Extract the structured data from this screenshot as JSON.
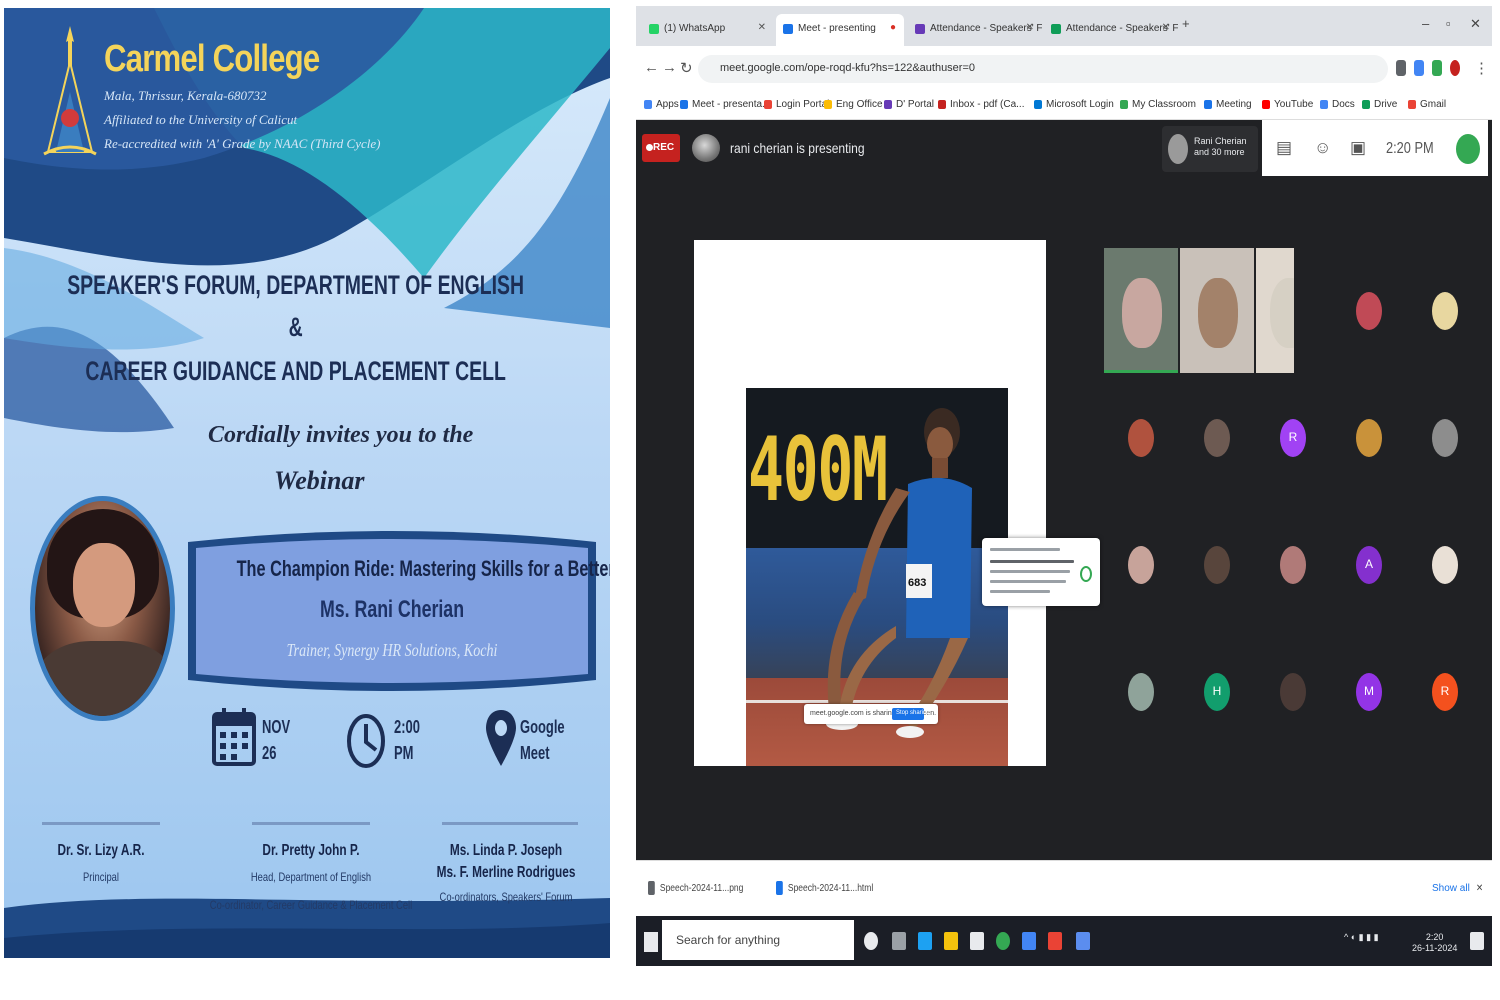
{
  "poster": {
    "college_name": "Carmel College",
    "address": "Mala, Thrissur, Kerala-680732",
    "affiliation": "Affiliated to the University of Calicut",
    "accreditation": "Re-accredited with 'A' Grade by NAAC (Third Cycle)",
    "heading_line1": "SPEAKER'S FORUM, DEPARTMENT OF ENGLISH",
    "heading_amp": "&",
    "heading_line2": "CAREER GUIDANCE AND PLACEMENT CELL",
    "invite_line1": "Cordially invites you to the",
    "invite_line2": "Webinar",
    "talk_title": "The Champion Ride: Mastering Skills for a Better Future",
    "speaker_name": "Ms. Rani Cherian",
    "speaker_role": "Trainer, Synergy HR Solutions, Kochi",
    "date_month": "NOV",
    "date_day": "26",
    "time_value": "2:00",
    "time_period": "PM",
    "venue_line1": "Google",
    "venue_line2": "Meet",
    "signatories": [
      {
        "name": "Dr. Sr. Lizy A.R.",
        "role": "Principal"
      },
      {
        "name": "Dr. Pretty John P.",
        "role_line1": "Head, Department of English",
        "role_line2": "Co-ordinator, Career Guidance & Placement Cell"
      },
      {
        "name_line1": "Ms. Linda P. Joseph",
        "name_line2": "Ms. F. Merline Rodrigues",
        "role": "Co-ordinators, Speakers' Forum"
      }
    ],
    "colors": {
      "background_top": "#d9ebfb",
      "wave_dark": "#1f4a86",
      "title_text": "#1c2e55",
      "college_name": "#f4d45a"
    }
  },
  "browser": {
    "tabs": [
      {
        "label": "(1) WhatsApp",
        "color": "#25d366"
      },
      {
        "label": "Meet - presenting",
        "color": "#1a73e8"
      },
      {
        "label": "Attendance - Speakers' Forum",
        "color": "#673ab7"
      },
      {
        "label": "Attendance - Speakers' Forum",
        "color": "#0f9d58"
      }
    ],
    "url": "meet.google.com/ope-roqd-kfu?hs=122&authuser=0",
    "bookmarks": [
      {
        "label": "Apps",
        "color": "#4285f4"
      },
      {
        "label": "Meet - presenta...",
        "color": "#1a73e8"
      },
      {
        "label": "Login Portal",
        "color": "#ea4335"
      },
      {
        "label": "Eng Office",
        "color": "#fbbc05"
      },
      {
        "label": "D' Portal",
        "color": "#673ab7"
      },
      {
        "label": "Inbox - pdf (Ca...",
        "color": "#c5221f"
      },
      {
        "label": "Microsoft Login",
        "color": "#0078d4"
      },
      {
        "label": "My Classroom",
        "color": "#34a853"
      },
      {
        "label": "Meeting",
        "color": "#1a73e8"
      },
      {
        "label": "YouTube",
        "color": "#ff0000"
      },
      {
        "label": "Docs",
        "color": "#4285f4"
      },
      {
        "label": "Drive",
        "color": "#0f9d58"
      },
      {
        "label": "Gmail",
        "color": "#ea4335"
      }
    ],
    "meet": {
      "rec_label": "REC",
      "presenting_text": "rani cherian is presenting",
      "pinned_line1": "Rani Cherian",
      "pinned_line2": "and 30 more",
      "clock": "2:20 PM",
      "slide_scoreboard": "400M",
      "athlete_bib": "683",
      "share_popup_text": "meet.google.com is sharing your screen.",
      "share_popup_button": "Stop sharing",
      "participants": [
        {
          "initial": "",
          "color": "#c8a7a0"
        },
        {
          "initial": "",
          "color": "#a3826a"
        },
        {
          "initial": "",
          "color": "#d6d0c4"
        },
        {
          "initial": "",
          "color": "#c04a56"
        },
        {
          "initial": "",
          "color": "#e8d7a0"
        },
        {
          "initial": "",
          "color": "#b0523e"
        },
        {
          "initial": "",
          "color": "#6d5a52"
        },
        {
          "initial": "R",
          "color": "#a142f4"
        },
        {
          "initial": "",
          "color": "#c9923a"
        },
        {
          "initial": "",
          "color": "#8d8d8d"
        },
        {
          "initial": "",
          "color": "#c7a39a"
        },
        {
          "initial": "",
          "color": "#58453c"
        },
        {
          "initial": "",
          "color": "#b07a78"
        },
        {
          "initial": "A",
          "color": "#8430ce"
        },
        {
          "initial": "",
          "color": "#e9e0d6"
        },
        {
          "initial": "",
          "color": "#8fa39a"
        },
        {
          "initial": "H",
          "color": "#129e6d"
        },
        {
          "initial": "",
          "color": "#4a3a36"
        },
        {
          "initial": "M",
          "color": "#9334e6"
        },
        {
          "initial": "R",
          "color": "#f4511e"
        }
      ]
    },
    "downloads": [
      {
        "label": "Speech-2024-11...png",
        "color": "#5f6368"
      },
      {
        "label": "Speech-2024-11...html",
        "color": "#1a73e8"
      }
    ],
    "show_all": "Show all",
    "taskbar_search": "Search for anything",
    "tray_time": "2:20",
    "tray_date": "26-11-2024"
  }
}
